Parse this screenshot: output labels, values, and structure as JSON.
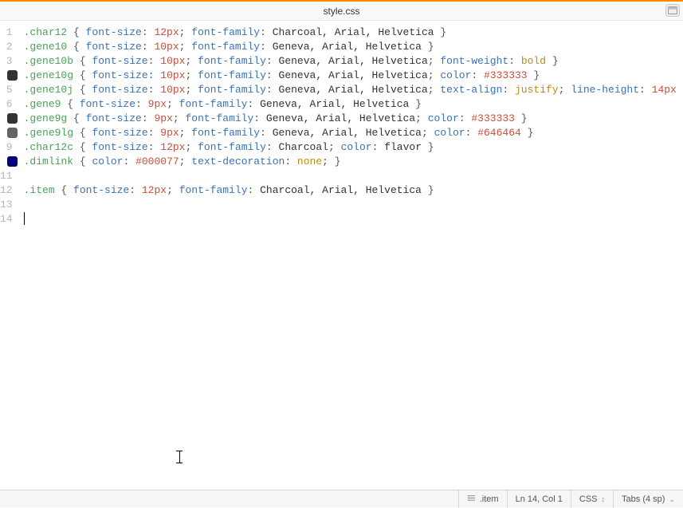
{
  "title": "style.css",
  "gutter": [
    {
      "n": "1"
    },
    {
      "n": "2"
    },
    {
      "n": "3"
    },
    {
      "n": "4",
      "swatch": "#333333"
    },
    {
      "n": "5"
    },
    {
      "n": "6"
    },
    {
      "n": "7",
      "swatch": "#333333"
    },
    {
      "n": "8",
      "swatch": "#646464"
    },
    {
      "n": "9"
    },
    {
      "n": "10",
      "swatch": "#000077"
    },
    {
      "n": "11"
    },
    {
      "n": "12"
    },
    {
      "n": "13"
    },
    {
      "n": "14"
    }
  ],
  "lines": [
    [
      [
        "sel",
        ".char12"
      ],
      [
        "pun",
        " { "
      ],
      [
        "prop",
        "font-size"
      ],
      [
        "pun",
        ": "
      ],
      [
        "num",
        "12px"
      ],
      [
        "pun",
        "; "
      ],
      [
        "prop",
        "font-family"
      ],
      [
        "pun",
        ": "
      ],
      [
        "str",
        "Charcoal, Arial, Helvetica"
      ],
      [
        "pun",
        " }"
      ]
    ],
    [
      [
        "sel",
        ".gene10"
      ],
      [
        "pun",
        " { "
      ],
      [
        "prop",
        "font-size"
      ],
      [
        "pun",
        ": "
      ],
      [
        "num",
        "10px"
      ],
      [
        "pun",
        "; "
      ],
      [
        "prop",
        "font-family"
      ],
      [
        "pun",
        ": "
      ],
      [
        "str",
        "Geneva, Arial, Helvetica"
      ],
      [
        "pun",
        " }"
      ]
    ],
    [
      [
        "sel",
        ".gene10b"
      ],
      [
        "pun",
        " { "
      ],
      [
        "prop",
        "font-size"
      ],
      [
        "pun",
        ": "
      ],
      [
        "num",
        "10px"
      ],
      [
        "pun",
        "; "
      ],
      [
        "prop",
        "font-family"
      ],
      [
        "pun",
        ": "
      ],
      [
        "str",
        "Geneva, Arial, Helvetica"
      ],
      [
        "pun",
        "; "
      ],
      [
        "prop",
        "font-weight"
      ],
      [
        "pun",
        ": "
      ],
      [
        "kw",
        "bold"
      ],
      [
        "pun",
        " }"
      ]
    ],
    [
      [
        "sel",
        ".gene10g"
      ],
      [
        "pun",
        " { "
      ],
      [
        "prop",
        "font-size"
      ],
      [
        "pun",
        ": "
      ],
      [
        "num",
        "10px"
      ],
      [
        "pun",
        "; "
      ],
      [
        "prop",
        "font-family"
      ],
      [
        "pun",
        ": "
      ],
      [
        "str",
        "Geneva, Arial, Helvetica"
      ],
      [
        "pun",
        "; "
      ],
      [
        "prop",
        "color"
      ],
      [
        "pun",
        ": "
      ],
      [
        "hash",
        "#333333"
      ],
      [
        "pun",
        " }"
      ]
    ],
    [
      [
        "sel",
        ".gene10j"
      ],
      [
        "pun",
        " { "
      ],
      [
        "prop",
        "font-size"
      ],
      [
        "pun",
        ": "
      ],
      [
        "num",
        "10px"
      ],
      [
        "pun",
        "; "
      ],
      [
        "prop",
        "font-family"
      ],
      [
        "pun",
        ": "
      ],
      [
        "str",
        "Geneva, Arial, Helvetica"
      ],
      [
        "pun",
        "; "
      ],
      [
        "prop",
        "text-align"
      ],
      [
        "pun",
        ": "
      ],
      [
        "kw",
        "justify"
      ],
      [
        "pun",
        "; "
      ],
      [
        "prop",
        "line-height"
      ],
      [
        "pun",
        ": "
      ],
      [
        "num",
        "14px"
      ],
      [
        "pun",
        " }"
      ]
    ],
    [
      [
        "sel",
        ".gene9"
      ],
      [
        "pun",
        " { "
      ],
      [
        "prop",
        "font-size"
      ],
      [
        "pun",
        ": "
      ],
      [
        "num",
        "9px"
      ],
      [
        "pun",
        "; "
      ],
      [
        "prop",
        "font-family"
      ],
      [
        "pun",
        ": "
      ],
      [
        "str",
        "Geneva, Arial, Helvetica"
      ],
      [
        "pun",
        " }"
      ]
    ],
    [
      [
        "sel",
        ".gene9g"
      ],
      [
        "pun",
        " { "
      ],
      [
        "prop",
        "font-size"
      ],
      [
        "pun",
        ": "
      ],
      [
        "num",
        "9px"
      ],
      [
        "pun",
        "; "
      ],
      [
        "prop",
        "font-family"
      ],
      [
        "pun",
        ": "
      ],
      [
        "str",
        "Geneva, Arial, Helvetica"
      ],
      [
        "pun",
        "; "
      ],
      [
        "prop",
        "color"
      ],
      [
        "pun",
        ": "
      ],
      [
        "hash",
        "#333333"
      ],
      [
        "pun",
        " }"
      ]
    ],
    [
      [
        "sel",
        ".gene9lg"
      ],
      [
        "pun",
        " { "
      ],
      [
        "prop",
        "font-size"
      ],
      [
        "pun",
        ": "
      ],
      [
        "num",
        "9px"
      ],
      [
        "pun",
        "; "
      ],
      [
        "prop",
        "font-family"
      ],
      [
        "pun",
        ": "
      ],
      [
        "str",
        "Geneva, Arial, Helvetica"
      ],
      [
        "pun",
        "; "
      ],
      [
        "prop",
        "color"
      ],
      [
        "pun",
        ": "
      ],
      [
        "hash",
        "#646464"
      ],
      [
        "pun",
        " }"
      ]
    ],
    [
      [
        "sel",
        ".char12c"
      ],
      [
        "pun",
        " { "
      ],
      [
        "prop",
        "font-size"
      ],
      [
        "pun",
        ": "
      ],
      [
        "num",
        "12px"
      ],
      [
        "pun",
        "; "
      ],
      [
        "prop",
        "font-family"
      ],
      [
        "pun",
        ": "
      ],
      [
        "str",
        "Charcoal"
      ],
      [
        "pun",
        "; "
      ],
      [
        "prop",
        "color"
      ],
      [
        "pun",
        ": "
      ],
      [
        "str",
        "flavor"
      ],
      [
        "pun",
        " }"
      ]
    ],
    [
      [
        "sel",
        ".dimlink"
      ],
      [
        "pun",
        " { "
      ],
      [
        "prop",
        "color"
      ],
      [
        "pun",
        ": "
      ],
      [
        "hash",
        "#000077"
      ],
      [
        "pun",
        "; "
      ],
      [
        "prop",
        "text-decoration"
      ],
      [
        "pun",
        ": "
      ],
      [
        "kw",
        "none"
      ],
      [
        "pun",
        "; }"
      ]
    ],
    [],
    [
      [
        "sel",
        ".item"
      ],
      [
        "pun",
        " { "
      ],
      [
        "prop",
        "font-size"
      ],
      [
        "pun",
        ": "
      ],
      [
        "num",
        "12px"
      ],
      [
        "pun",
        "; "
      ],
      [
        "prop",
        "font-family"
      ],
      [
        "pun",
        ": "
      ],
      [
        "str",
        "Charcoal, Arial, Helvetica"
      ],
      [
        "pun",
        " }"
      ]
    ],
    [],
    []
  ],
  "cursor_line_index": 13,
  "status": {
    "breadcrumb": ".item",
    "position": "Ln 14, Col 1",
    "language": "CSS",
    "indent": "Tabs (4 sp)"
  }
}
